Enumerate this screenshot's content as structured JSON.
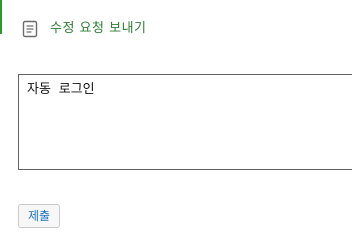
{
  "header": {
    "icon": "document-icon",
    "title": "수정 요청 보내기"
  },
  "form": {
    "textarea_value": "자동 로그인"
  },
  "actions": {
    "submit_label": "제출"
  },
  "colors": {
    "accent": "#2e7d32",
    "link": "#1e73c8",
    "border": "#5f6368"
  }
}
